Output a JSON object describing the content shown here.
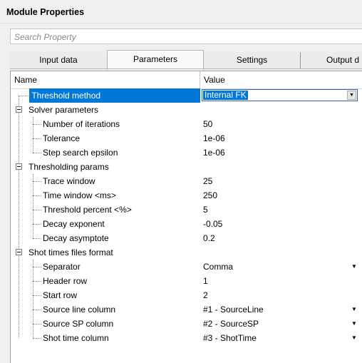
{
  "window": {
    "title": "Module Properties"
  },
  "search": {
    "placeholder": "Search Property"
  },
  "tabs": [
    {
      "label": "Input data",
      "active": false
    },
    {
      "label": "Parameters",
      "active": true
    },
    {
      "label": "Settings",
      "active": false
    },
    {
      "label": "Output d",
      "active": false
    }
  ],
  "grid": {
    "headers": {
      "name": "Name",
      "value": "Value"
    },
    "rows": [
      {
        "label": "Threshold method",
        "value": "Internal FK",
        "level": 0,
        "selected": true,
        "dropdown": true
      },
      {
        "label": "Solver parameters",
        "value": "",
        "group": true
      },
      {
        "label": "Number of iterations",
        "value": "50",
        "level": 1
      },
      {
        "label": "Tolerance",
        "value": "1e-06",
        "level": 1
      },
      {
        "label": "Step search epsilon",
        "value": "1e-06",
        "level": 1
      },
      {
        "label": "Thresholding params",
        "value": "",
        "group": true
      },
      {
        "label": "Trace window",
        "value": "25",
        "level": 1
      },
      {
        "label": "Time window <ms>",
        "value": "250",
        "level": 1
      },
      {
        "label": "Threshold percent <%>",
        "value": "5",
        "level": 1
      },
      {
        "label": "Decay exponent",
        "value": "-0.05",
        "level": 1
      },
      {
        "label": "Decay asymptote",
        "value": "0.2",
        "level": 1
      },
      {
        "label": "Shot times files format",
        "value": "",
        "group": true
      },
      {
        "label": "Separator",
        "value": "Comma",
        "level": 1,
        "dropdown": true
      },
      {
        "label": "Header row",
        "value": "1",
        "level": 1
      },
      {
        "label": "Start row",
        "value": "2",
        "level": 1
      },
      {
        "label": "Source line column",
        "value": "#1 - SourceLine",
        "level": 1,
        "dropdown": true
      },
      {
        "label": "Source SP column",
        "value": "#2 - SourceSP",
        "level": 1,
        "dropdown": true
      },
      {
        "label": "Shot time column",
        "value": "#3 - ShotTime",
        "level": 1,
        "dropdown": true
      }
    ]
  },
  "icons": {
    "collapse": "minus-box-icon",
    "dropdown": "chevron-down-icon"
  },
  "colors": {
    "selection": "#0078d7",
    "background": "#f0f0f0"
  }
}
